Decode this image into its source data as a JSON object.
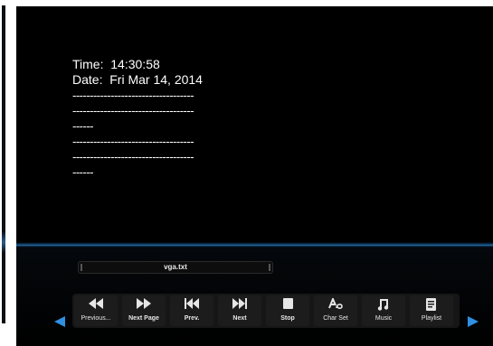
{
  "screen": {
    "time_label": "Time:",
    "time_value": "14:30:58",
    "date_label": "Date:",
    "date_value": "Fri Mar 14, 2014",
    "lines": [
      "-----------------------------------",
      "-----------------------------------",
      "------",
      "-----------------------------------",
      "-----------------------------------",
      "------"
    ]
  },
  "player": {
    "filename": "vga.txt",
    "buttons": [
      {
        "label": "Previous...",
        "icon": "rewind-icon"
      },
      {
        "label": "Next Page",
        "icon": "fast-forward-icon"
      },
      {
        "label": "Prev.",
        "icon": "skip-previous-icon"
      },
      {
        "label": "Next",
        "icon": "skip-next-icon"
      },
      {
        "label": "Stop",
        "icon": "stop-icon"
      },
      {
        "label": "Char Set",
        "icon": "char-set-icon"
      },
      {
        "label": "Music",
        "icon": "music-note-icon"
      },
      {
        "label": "Playlist",
        "icon": "playlist-icon"
      }
    ]
  },
  "colors": {
    "background": "#000000",
    "accent": "#2f8fe0",
    "text": "#ffffff"
  }
}
